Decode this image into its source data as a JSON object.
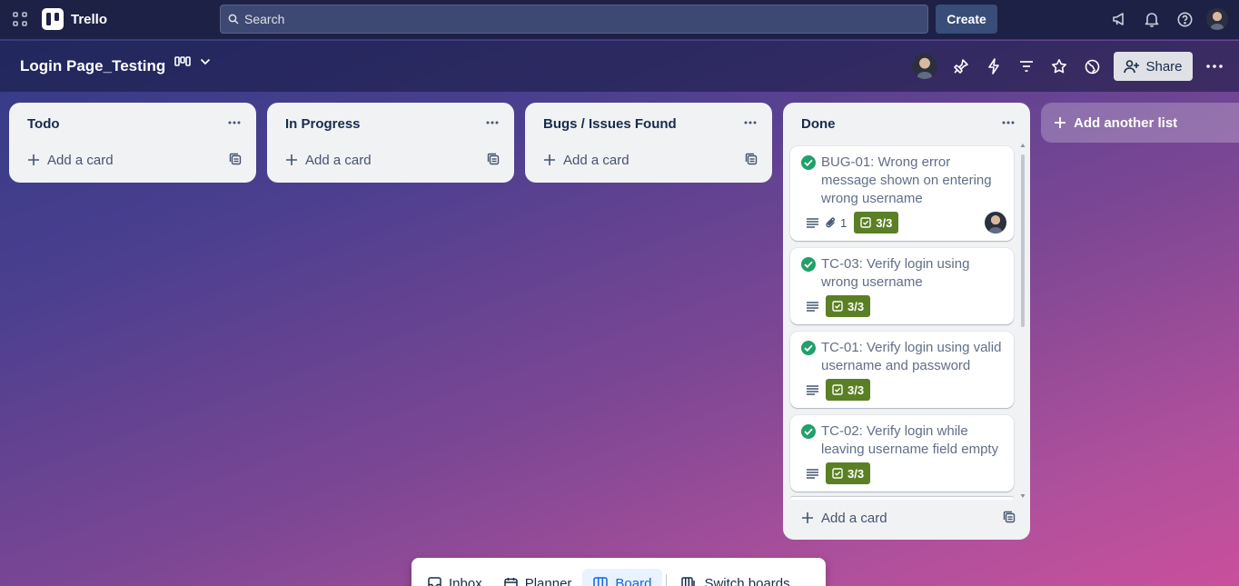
{
  "app": {
    "name": "Trello"
  },
  "topbar": {
    "search_placeholder": "Search",
    "create_label": "Create"
  },
  "board": {
    "title": "Login Page_Testing",
    "share_label": "Share"
  },
  "lists": [
    {
      "title": "Todo",
      "add_card_label": "Add a card"
    },
    {
      "title": "In Progress",
      "add_card_label": "Add a card"
    },
    {
      "title": "Bugs / Issues Found",
      "add_card_label": "Add a card"
    },
    {
      "title": "Done",
      "add_card_label": "Add a card",
      "cards": [
        {
          "title": "BUG-01: Wrong error message shown on entering wrong username",
          "attachments": "1",
          "checklist": "3/3",
          "has_member": true
        },
        {
          "title": "TC-03: Verify login using wrong username",
          "checklist": "3/3"
        },
        {
          "title": "TC-01: Verify login using valid username and password",
          "checklist": "3/3"
        },
        {
          "title": "TC-02: Verify login while leaving username field empty",
          "checklist": "3/3"
        }
      ]
    }
  ],
  "add_list_label": "Add another list",
  "bottom_nav": {
    "inbox": "Inbox",
    "planner": "Planner",
    "board": "Board",
    "switch_boards": "Switch boards"
  },
  "colors": {
    "checklist_complete": "#5b7f24",
    "card_done_check": "#22a06b",
    "active_nav": "#0c66e4"
  }
}
